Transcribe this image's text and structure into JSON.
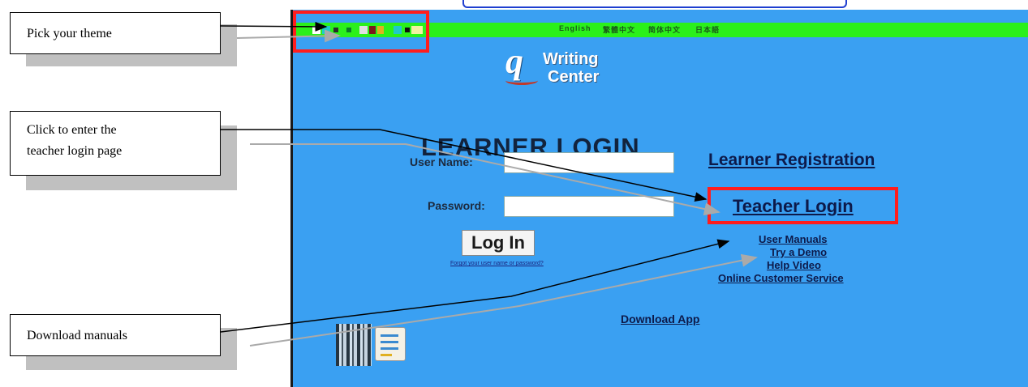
{
  "screen": {
    "language_links": [
      "English",
      "繁體中文",
      "简体中文",
      "日本語"
    ],
    "theme_swatch_colors": [
      "#ffffff",
      "#1ec9c9",
      "#2a2a2a",
      "#0a7a2a",
      "#e0e0e0",
      "#7a1a1a",
      "#e0b020",
      "#1ec9c9",
      "#101010",
      "#f2f2a0"
    ],
    "logo": {
      "glyph": "q",
      "line1": "Writing",
      "line2": "Center"
    },
    "page_title": "LEARNER LOGIN",
    "username_label": "User Name:",
    "password_label": "Password:",
    "login_button": "Log In",
    "forgot_link": "Forgot your user name or password?",
    "learner_registration": "Learner Registration",
    "teacher_login": "Teacher Login",
    "help_links": [
      "User Manuals",
      "Try a Demo",
      "Help Video",
      "Online Customer Service"
    ],
    "download_app": "Download App"
  },
  "callouts": {
    "theme": "Pick your theme",
    "teacher_line1": "Click to enter the",
    "teacher_line2": "teacher login page",
    "manuals": "Download manuals"
  },
  "colors": {
    "highlight": "#ff1d1d",
    "page_bg": "#3aa0f2",
    "topbar": "#2bf01b"
  }
}
